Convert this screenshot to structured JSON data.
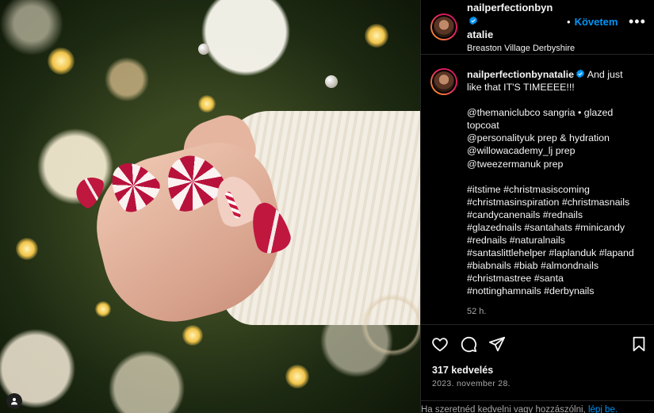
{
  "post": {
    "username": "nailperfectionbynatalie",
    "username_header_line1": "nailperfectionbyn",
    "username_header_line2": "atalie",
    "location": "Breaston Village Derbyshire",
    "follow_label": "Követem",
    "dot": "•",
    "more_label": "•••",
    "caption_intro": "And just like that IT'S TIMEEEE!!!",
    "caption_lines": [
      "@themaniclubco sangria • glazed topcoat",
      "@personalityuk prep & hydration",
      "@willowacademy_lj prep",
      "@tweezermanuk prep"
    ],
    "hashtags": "#itstime #christmasiscoming #christmasinspiration #christmasnails #candycanenails #rednails #glazednails #santahats #minicandy #rednails #naturalnails #santaslittlehelper #laplanduk #lapand #biabnails #biab #almondnails #christmastree #santa #nottinghamnails #derbynails",
    "caption_time": "52 h.",
    "likes": "317 kedvelés",
    "date": "2023. november 28."
  },
  "footer": {
    "prompt": "Ha szeretnéd kedvelni vagy hozzászólni, ",
    "login_link": "lépj be."
  },
  "icons": {
    "verified": "verified-badge-icon",
    "like": "heart-icon",
    "comment": "comment-icon",
    "share": "paper-plane-icon",
    "save": "bookmark-icon",
    "tag": "user-tag-icon"
  },
  "colors": {
    "background": "#000000",
    "accent": "#0095f6",
    "text": "#f5f5f5",
    "muted": "#a8a8a8",
    "divider": "#262626"
  }
}
